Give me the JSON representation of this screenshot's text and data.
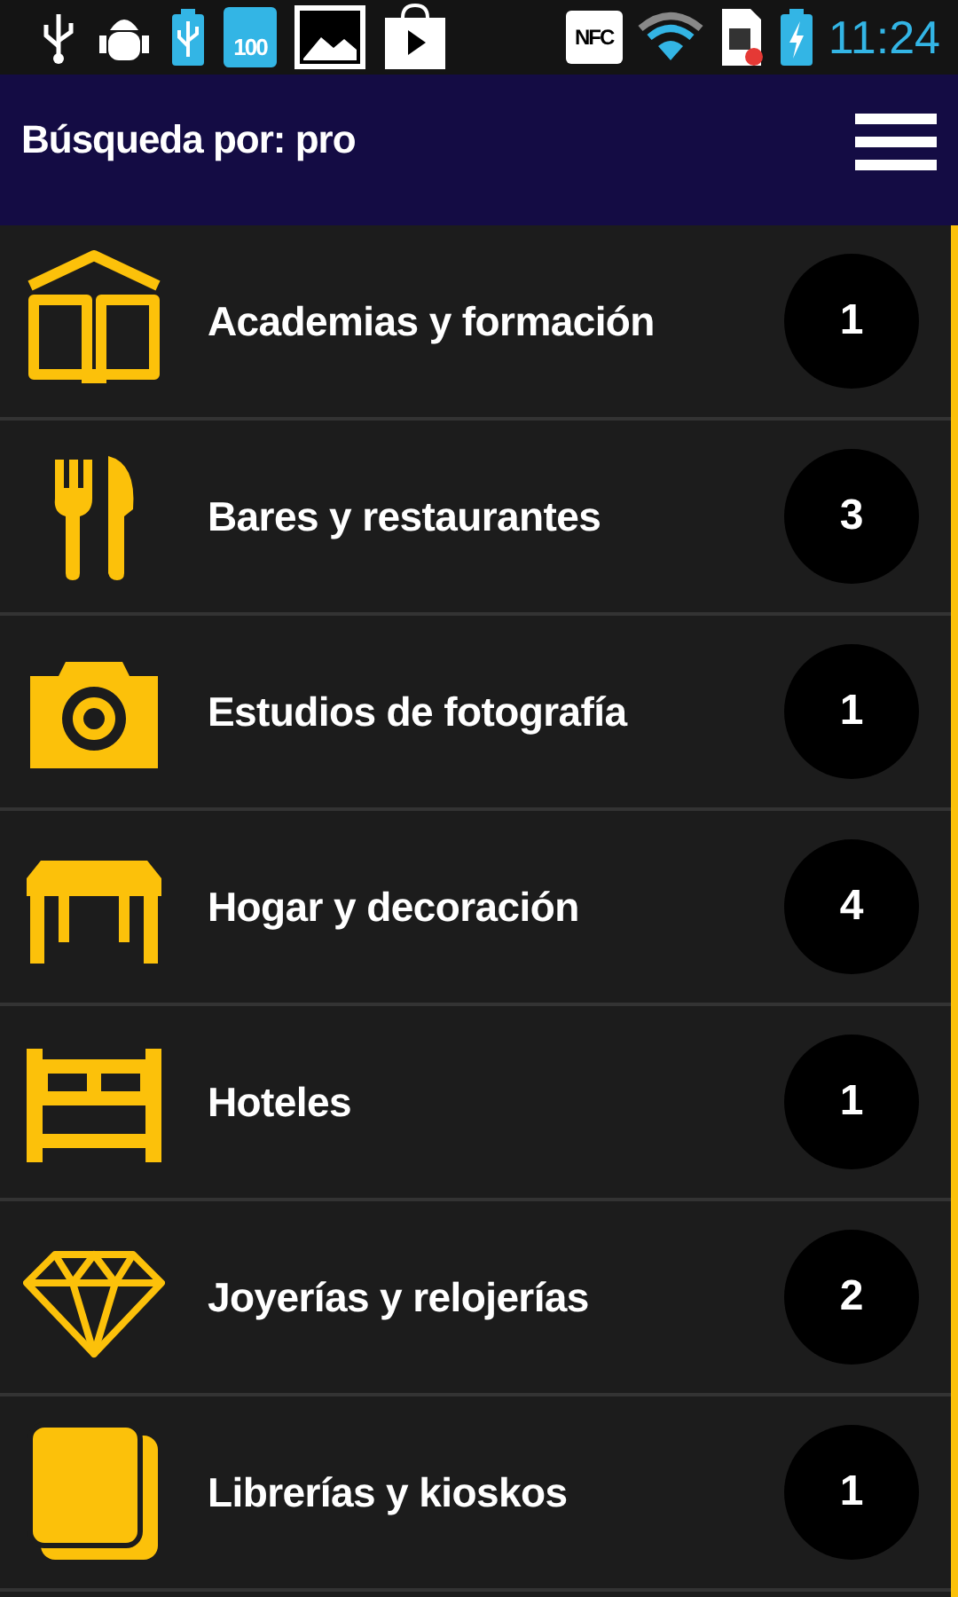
{
  "status_bar": {
    "battery_label": "100",
    "nfc_label": "NFC",
    "time": "11:24"
  },
  "header": {
    "title": "Búsqueda por: pro"
  },
  "categories": [
    {
      "kind": "book",
      "label": "Academias y formación",
      "count": "1"
    },
    {
      "kind": "cutlery",
      "label": "Bares y restaurantes",
      "count": "3"
    },
    {
      "kind": "camera",
      "label": "Estudios de fotografía",
      "count": "1"
    },
    {
      "kind": "table",
      "label": "Hogar y decoración",
      "count": "4"
    },
    {
      "kind": "bed",
      "label": "Hoteles",
      "count": "1"
    },
    {
      "kind": "diamond",
      "label": "Joyerías y relojerías",
      "count": "2"
    },
    {
      "kind": "cards",
      "label": "Librerías y kioskos",
      "count": "1"
    }
  ]
}
